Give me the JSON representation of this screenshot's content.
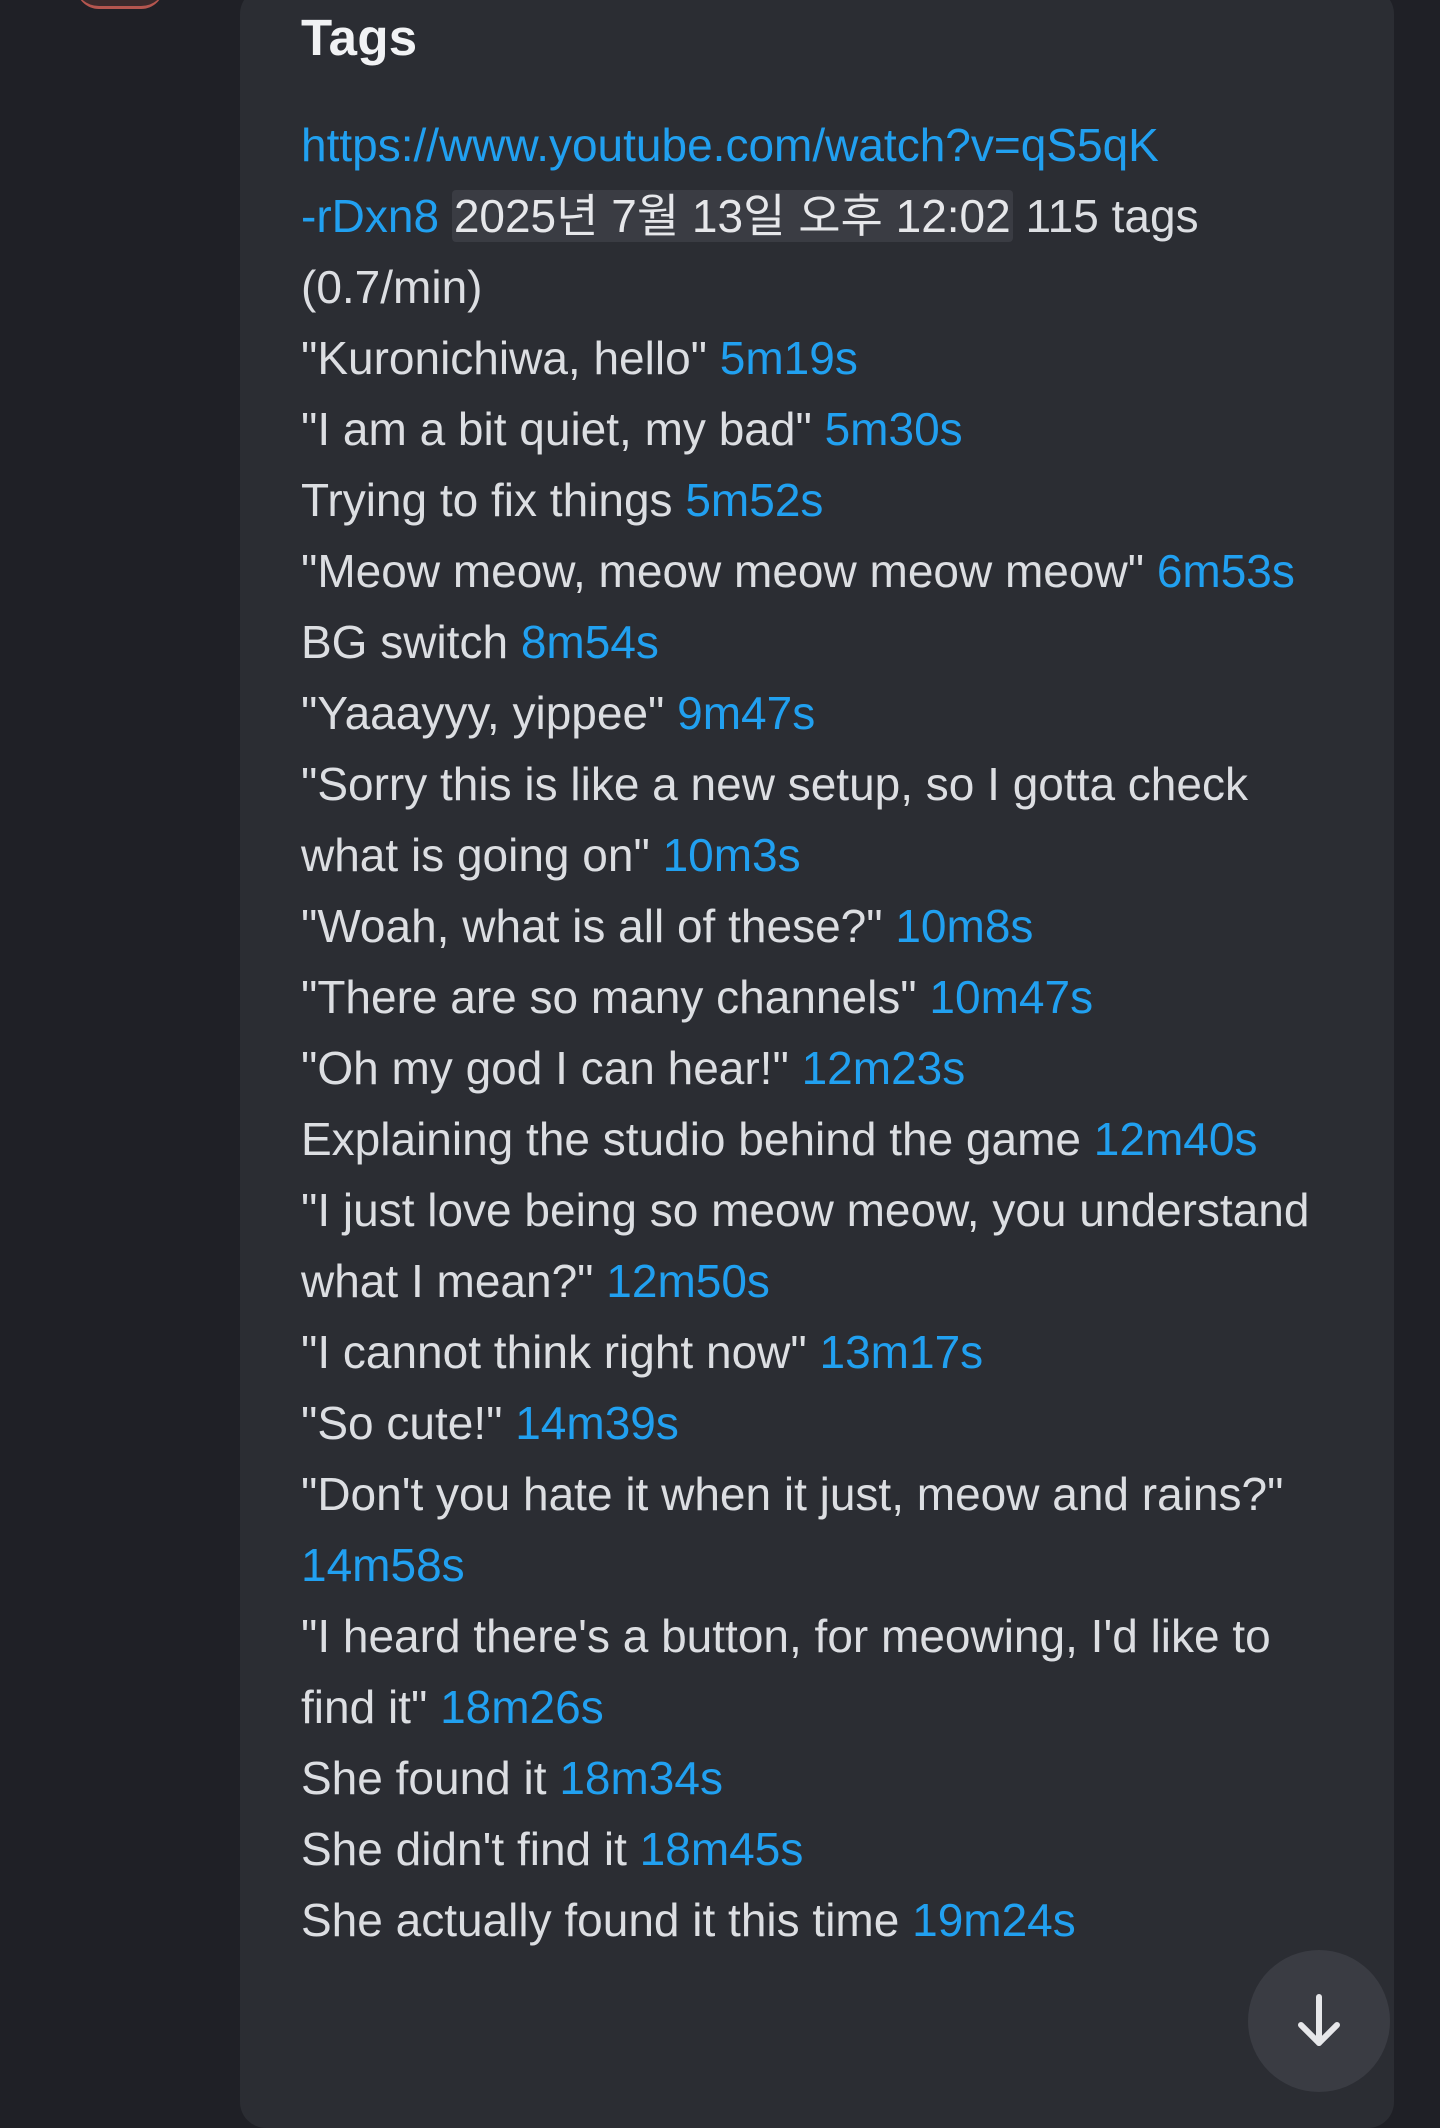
{
  "embed": {
    "title": "Tags",
    "video_url": "https://www.youtube.com/watch?v=qS5qK-rDxn8",
    "video_url_line1": "https://www.youtube.com/watch?v=qS5qK",
    "video_url_line2": "-rDxn8",
    "date": "2025년 7월 13일 오후 12:02",
    "tag_count": "115 tags",
    "rate": "(0.7/min)"
  },
  "tags": [
    {
      "text": "\"Kuronichiwa, hello\"",
      "time": "5m19s"
    },
    {
      "text": "\"I am a bit quiet, my bad\"",
      "time": "5m30s"
    },
    {
      "text": "Trying to fix things",
      "time": "5m52s"
    },
    {
      "text": "\"Meow meow, meow meow meow meow\"",
      "time": "6m53s"
    },
    {
      "text": "BG switch",
      "time": "8m54s"
    },
    {
      "text": "\"Yaaayyy, yippee\"",
      "time": "9m47s"
    },
    {
      "text": "\"Sorry this is like a new setup, so I gotta check what is going on\"",
      "time": "10m3s"
    },
    {
      "text": "\"Woah, what is all of these?\"",
      "time": "10m8s"
    },
    {
      "text": "\"There are so many channels\"",
      "time": "10m47s"
    },
    {
      "text": "\"Oh my god I can hear!\"",
      "time": "12m23s"
    },
    {
      "text": "Explaining the studio behind the game",
      "time": "12m40s"
    },
    {
      "text": "\"I just love being so meow meow, you understand what I mean?\"",
      "time": "12m50s"
    },
    {
      "text": "\"I cannot think right now\"",
      "time": "13m17s"
    },
    {
      "text": "\"So cute!\"",
      "time": "14m39s"
    },
    {
      "text": "\"Don't you hate it when it just, meow and rains?\"",
      "time": "14m58s"
    },
    {
      "text": "\"I heard there's a button, for meowing, I'd like to find it\"",
      "time": "18m26s"
    },
    {
      "text": "She found it",
      "time": "18m34s"
    },
    {
      "text": "She didn't find it",
      "time": "18m45s"
    },
    {
      "text": "She actually found it this time",
      "time": "19m24s"
    }
  ],
  "scroll_button": {
    "icon": "arrow-down-icon"
  },
  "colors": {
    "background": "#1f2026",
    "embed_background": "#2b2d33",
    "link": "#21a0f0",
    "text": "#dcdee2",
    "title": "#f1f2f4"
  }
}
